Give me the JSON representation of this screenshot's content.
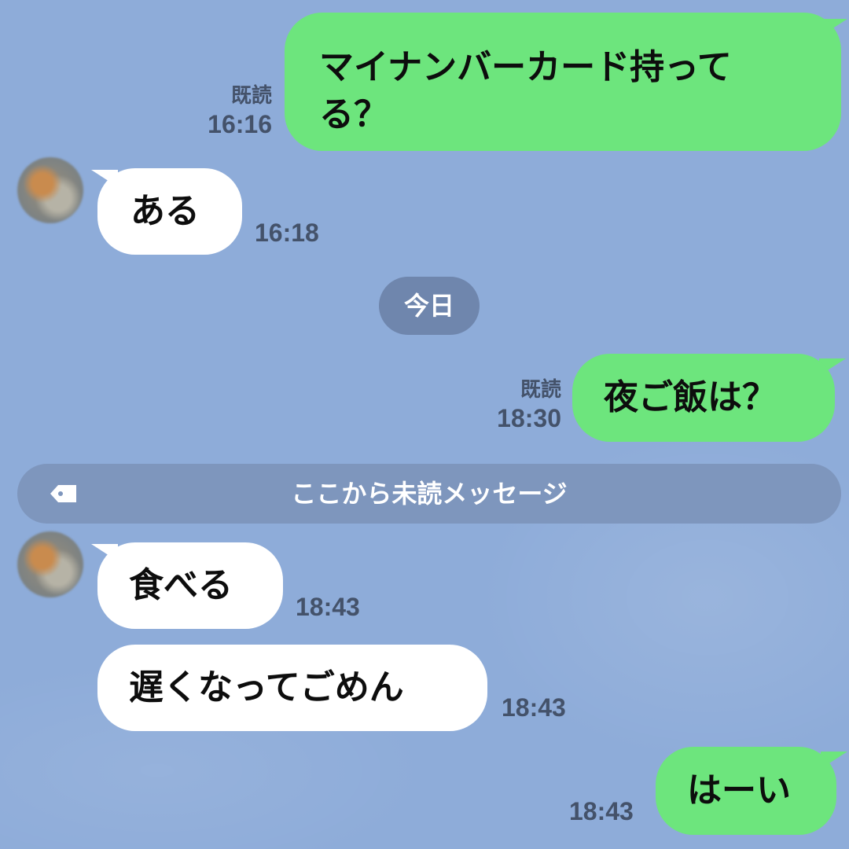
{
  "messages": [
    {
      "id": "m1",
      "side": "out",
      "text_line1": "マイナンバーカード持って",
      "text_line2": "る？",
      "read": "既読",
      "time": "16:16"
    },
    {
      "id": "m2",
      "side": "in",
      "text": "ある",
      "time": "16:18"
    },
    {
      "id": "m3",
      "side": "out",
      "text": "夜ご飯は？",
      "read": "既読",
      "time": "18:30"
    },
    {
      "id": "m4",
      "side": "in",
      "text": "食べる",
      "time": "18:43"
    },
    {
      "id": "m5",
      "side": "in",
      "text": "遅くなってごめん",
      "time": "18:43"
    },
    {
      "id": "m6",
      "side": "out",
      "text": "はーい",
      "time": "18:43"
    }
  ],
  "date_separator": "今日",
  "unread_divider": {
    "label": "ここから未読メッセージ",
    "icon": "tag-icon"
  },
  "colors": {
    "background": "#8eacd9",
    "outgoing_bubble": "#6de57d",
    "incoming_bubble": "#ffffff",
    "meta_text": "#44526a",
    "chip": "#6f86ad",
    "divider": "#7e96bd"
  }
}
